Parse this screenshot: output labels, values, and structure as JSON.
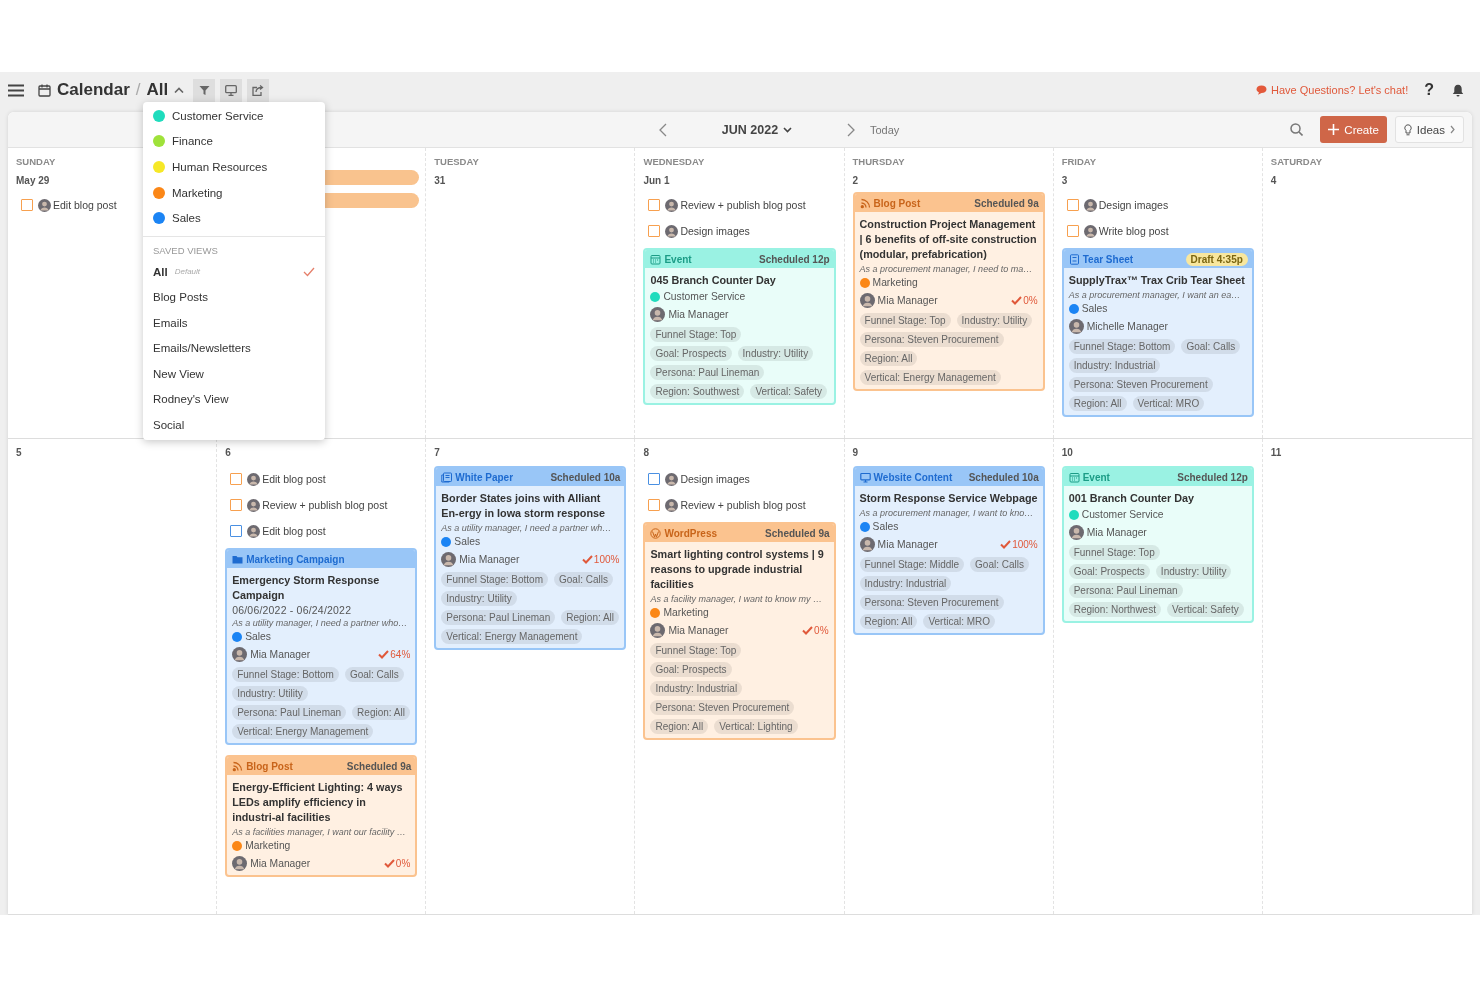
{
  "header": {
    "title": "Calendar",
    "separator": "/",
    "view": "All",
    "chat": "Have Questions? Let's chat!",
    "help": "?"
  },
  "toolbar": {
    "month": "JUN 2022",
    "today": "Today",
    "create": "Create",
    "ideas": "Ideas"
  },
  "dropdown": {
    "teams": [
      {
        "name": "Customer Service",
        "color": "#1fdcbd"
      },
      {
        "name": "Finance",
        "color": "#9fe23a"
      },
      {
        "name": "Human Resources",
        "color": "#f6e827"
      },
      {
        "name": "Marketing",
        "color": "#fb8717"
      },
      {
        "name": "Sales",
        "color": "#1b84f4"
      }
    ],
    "saved_heading": "SAVED VIEWS",
    "views": [
      {
        "name": "All",
        "note": "Default",
        "selected": true
      },
      {
        "name": "Blog Posts",
        "selected": false
      },
      {
        "name": "Emails",
        "selected": false
      },
      {
        "name": "Emails/Newsletters",
        "selected": false
      },
      {
        "name": "New View",
        "selected": false
      },
      {
        "name": "Rodney's View",
        "selected": false
      },
      {
        "name": "Social",
        "selected": false
      }
    ]
  },
  "weeks": [
    {
      "days": [
        {
          "weekday": "SUNDAY",
          "date": "May 29",
          "items": [
            {
              "kind": "task",
              "label": "Edit blog post",
              "color": "#f7a04f",
              "checked": false
            }
          ]
        },
        {
          "items": [
            {
              "kind": "bar"
            },
            {
              "kind": "bar"
            }
          ]
        },
        {
          "weekday": "TUESDAY",
          "date": "31"
        },
        {
          "weekday": "WEDNESDAY",
          "date": "Jun 1",
          "items": [
            {
              "kind": "task",
              "label": "Review + publish blog post",
              "color": "#f7a04f",
              "checked": false
            },
            {
              "kind": "task",
              "label": "Design images",
              "color": "#f7a04f",
              "checked": false
            },
            {
              "kind": "event",
              "type": "Event",
              "status": "Scheduled 12p",
              "draft": false,
              "title": "045 Branch Counter Day",
              "team": {
                "name": "Customer Service",
                "color": "#1fdcbd"
              },
              "owner": "Mia Manager",
              "tags": [
                "Funnel Stage: Top",
                "Goal: Prospects",
                "Industry: Utility",
                "Persona: Paul Lineman",
                "Region: Southwest",
                "Vertical: Safety"
              ]
            }
          ]
        },
        {
          "weekday": "THURSDAY",
          "date": "2",
          "items": [
            {
              "kind": "blog",
              "type": "Blog Post",
              "status": "Scheduled 9a",
              "draft": false,
              "title": "Construction Project Management | 6 benefits of off-site construction (modular, prefabrication)",
              "description": "As a procurement manager, I need to ma…",
              "team": {
                "name": "Marketing",
                "color": "#fb8717"
              },
              "owner": "Mia Manager",
              "progress": "0%",
              "tags": [
                "Funnel Stage: Top",
                "Industry: Utility",
                "Persona: Steven Procurement",
                "Region: All",
                "Vertical: Energy Management"
              ]
            }
          ]
        },
        {
          "weekday": "FRIDAY",
          "date": "3",
          "items": [
            {
              "kind": "task",
              "label": "Design images",
              "color": "#f7a04f",
              "checked": false
            },
            {
              "kind": "task",
              "label": "Write blog post",
              "color": "#f7a04f",
              "checked": false
            },
            {
              "kind": "sheet",
              "type": "Tear Sheet",
              "status": "Draft 4:35p",
              "draft": true,
              "title": "SupplyTrax™ Trax Crib Tear Sheet",
              "description": "As a procurement manager, I want an ea…",
              "team": {
                "name": "Sales",
                "color": "#1b84f4"
              },
              "owner": "Michelle Manager",
              "tags": [
                "Funnel Stage: Bottom",
                "Goal: Calls",
                "Industry: Industrial",
                "Persona: Steven Procurement",
                "Region: All",
                "Vertical: MRO"
              ]
            }
          ]
        },
        {
          "weekday": "SATURDAY",
          "date": "4"
        }
      ]
    },
    {
      "days": [
        {
          "date": "5"
        },
        {
          "date": "6",
          "items": [
            {
              "kind": "task",
              "label": "Edit blog post",
              "color": "#f7a04f",
              "checked": false
            },
            {
              "kind": "task",
              "label": "Review + publish blog post",
              "color": "#f7a04f",
              "checked": false
            },
            {
              "kind": "task",
              "label": "Edit blog post",
              "color": "#4a90e2",
              "checked": false
            },
            {
              "kind": "campaign",
              "type": "Marketing Campaign",
              "title": "Emergency Storm Response Campaign",
              "dates": "06/06/2022 - 06/24/2022",
              "description": "As a utility manager, I need a partner who…",
              "team": {
                "name": "Sales",
                "color": "#1b84f4"
              },
              "owner": "Mia Manager",
              "progress": "64%",
              "tags": [
                "Funnel Stage: Bottom",
                "Goal: Calls",
                "Industry: Utility",
                "Persona: Paul Lineman",
                "Region: All",
                "Vertical: Energy Management"
              ]
            },
            {
              "kind": "blog",
              "type": "Blog Post",
              "status": "Scheduled 9a",
              "draft": false,
              "title": "Energy-Efficient Lighting: 4 ways LEDs amplify efficiency in industri-al facilities",
              "description": "As a facilities manager, I want our facility …",
              "team": {
                "name": "Marketing",
                "color": "#fb8717"
              },
              "owner": "Mia Manager",
              "progress": "0%"
            }
          ]
        },
        {
          "date": "7",
          "items": [
            {
              "kind": "paper",
              "type": "White Paper",
              "status": "Scheduled 10a",
              "draft": false,
              "title": "Border States joins with Alliant En-ergy in Iowa storm response",
              "description": "As a utility manager, I need a partner wh…",
              "team": {
                "name": "Sales",
                "color": "#1b84f4"
              },
              "owner": "Mia Manager",
              "progress": "100%",
              "tags": [
                "Funnel Stage: Bottom",
                "Goal: Calls",
                "Industry: Utility",
                "Persona: Paul Lineman",
                "Region: All",
                "Vertical: Energy Management"
              ]
            }
          ]
        },
        {
          "date": "8",
          "items": [
            {
              "kind": "task",
              "label": "Design images",
              "color": "#4a90e2",
              "checked": false
            },
            {
              "kind": "task",
              "label": "Review + publish blog post",
              "color": "#f7a04f",
              "checked": false
            },
            {
              "kind": "wordpress",
              "type": "WordPress",
              "status": "Scheduled 9a",
              "draft": false,
              "title": "Smart lighting control systems | 9 reasons to upgrade industrial facilities",
              "description": "As a facility manager, I want to know my …",
              "team": {
                "name": "Marketing",
                "color": "#fb8717"
              },
              "owner": "Mia Manager",
              "progress": "0%",
              "tags": [
                "Funnel Stage: Top",
                "Goal: Prospects",
                "Industry: Industrial",
                "Persona: Steven Procurement",
                "Region: All",
                "Vertical: Lighting"
              ]
            }
          ]
        },
        {
          "date": "9",
          "items": [
            {
              "kind": "website",
              "type": "Website Content",
              "status": "Scheduled 10a",
              "draft": false,
              "title": "Storm Response Service Webpage",
              "description": "As a procurement manager, I want to kno…",
              "team": {
                "name": "Sales",
                "color": "#1b84f4"
              },
              "owner": "Mia Manager",
              "progress": "100%",
              "tags": [
                "Funnel Stage: Middle",
                "Goal: Calls",
                "Industry: Industrial",
                "Persona: Steven Procurement",
                "Region: All",
                "Vertical: MRO"
              ]
            }
          ]
        },
        {
          "date": "10",
          "items": [
            {
              "kind": "event",
              "type": "Event",
              "status": "Scheduled 12p",
              "draft": false,
              "title": "001 Branch Counter Day",
              "team": {
                "name": "Customer Service",
                "color": "#1fdcbd"
              },
              "owner": "Mia Manager",
              "tags": [
                "Funnel Stage: Top",
                "Goal: Prospects",
                "Industry: Utility",
                "Persona: Paul Lineman",
                "Region: Northwest",
                "Vertical: Safety"
              ]
            }
          ]
        },
        {
          "date": "11"
        }
      ]
    }
  ]
}
